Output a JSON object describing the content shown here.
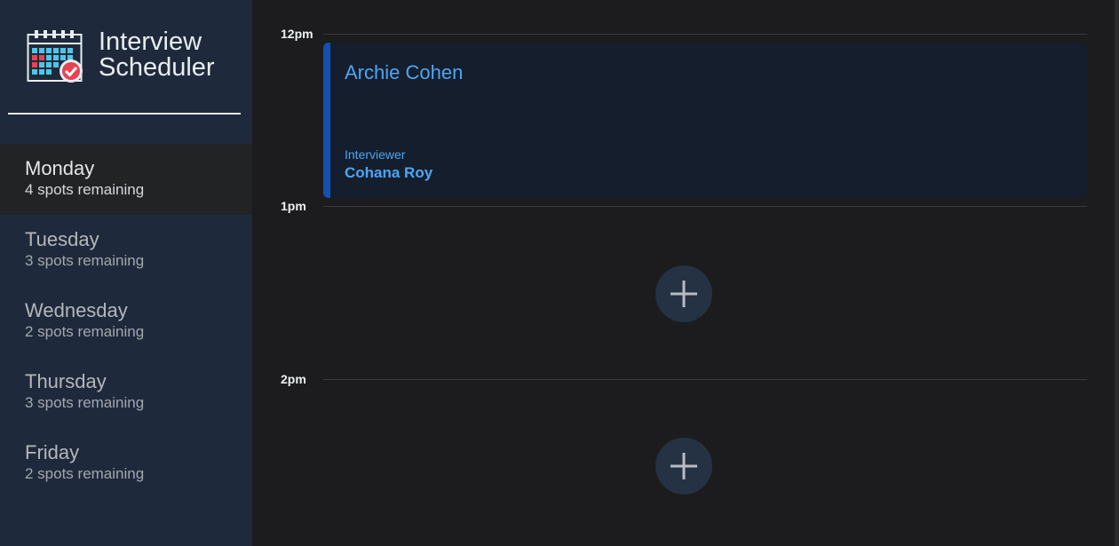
{
  "brand": {
    "title_line1": "Interview",
    "title_line2": "Scheduler",
    "icon": "calendar-check-icon"
  },
  "sidebar": {
    "days": [
      {
        "name": "Monday",
        "spots": "4 spots remaining",
        "selected": true
      },
      {
        "name": "Tuesday",
        "spots": "3 spots remaining",
        "selected": false
      },
      {
        "name": "Wednesday",
        "spots": "2 spots remaining",
        "selected": false
      },
      {
        "name": "Thursday",
        "spots": "3 spots remaining",
        "selected": false
      },
      {
        "name": "Friday",
        "spots": "2 spots remaining",
        "selected": false
      }
    ]
  },
  "schedule": {
    "slots": [
      {
        "time": "12pm",
        "appointment": {
          "student": "Archie Cohen",
          "interviewer_label": "Interviewer",
          "interviewer": "Cohana Roy"
        }
      },
      {
        "time": "1pm",
        "add_icon": "plus-icon"
      },
      {
        "time": "2pm",
        "add_icon": "plus-icon"
      }
    ]
  },
  "colors": {
    "sidebar_bg": "#1e2a3c",
    "main_bg": "#1c1c1e",
    "accent_text": "#4da6f3",
    "appointment_bar": "#1450b0",
    "appointment_bg": "#141e2d"
  }
}
